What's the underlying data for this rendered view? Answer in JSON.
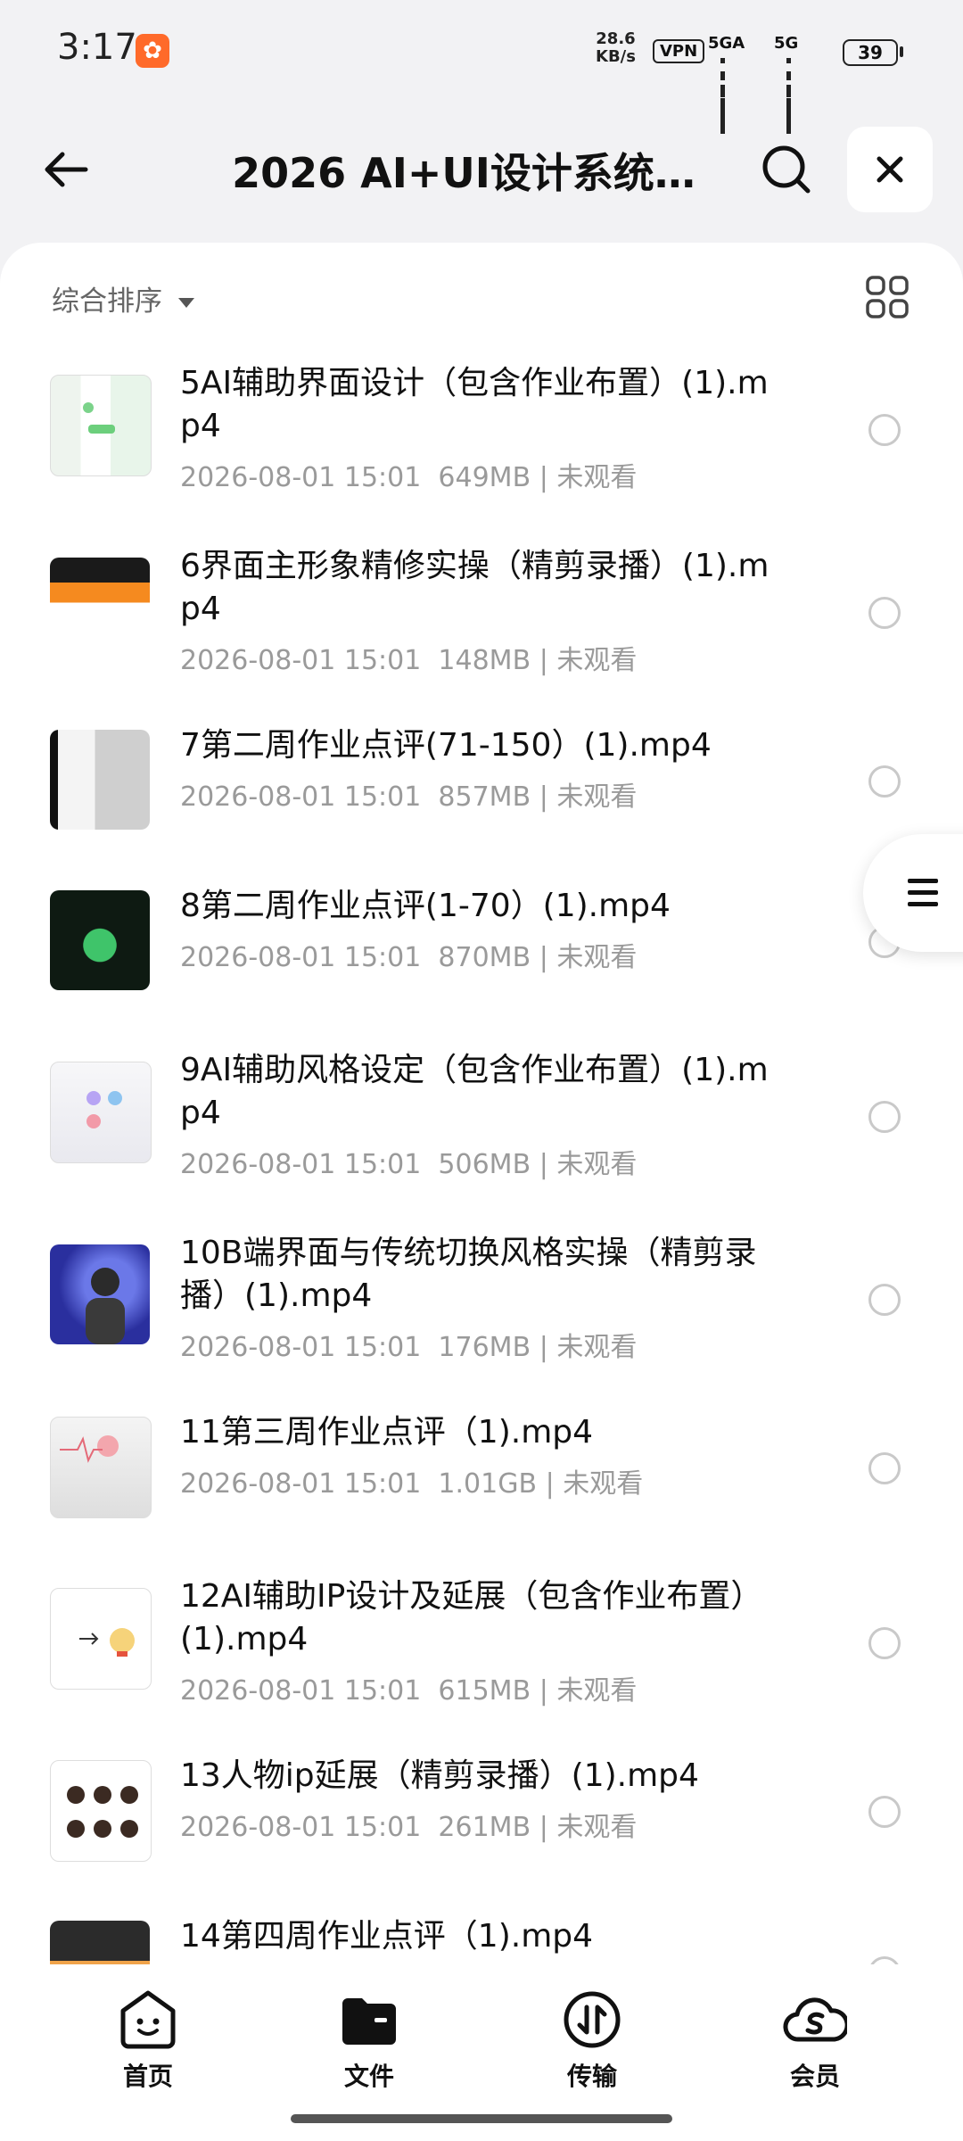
{
  "status_bar": {
    "time": "3:17",
    "app_badge_icon": "app-notification-icon",
    "net_speed_value": "28.6",
    "net_speed_unit": "KB/s",
    "vpn": "VPN",
    "sim1": "5GA",
    "sim2": "5G",
    "battery": "39"
  },
  "header": {
    "title": "2026 AI+UI设计系统…",
    "back_icon": "arrow-left-icon",
    "search_icon": "search-icon",
    "close_icon": "close-icon"
  },
  "toolbar": {
    "sort_label": "综合排序",
    "view_toggle_icon": "grid-view-icon"
  },
  "files": [
    {
      "name": "5AI辅助界面设计（包含作业布置）(1).mp4",
      "date": "2026-08-01 15:01",
      "size": "649MB",
      "status": "未观看"
    },
    {
      "name": "6界面主形象精修实操（精剪录播）(1).mp4",
      "date": "2026-08-01 15:01",
      "size": "148MB",
      "status": "未观看"
    },
    {
      "name": "7第二周作业点评(71-150）(1).mp4",
      "date": "2026-08-01 15:01",
      "size": "857MB",
      "status": "未观看"
    },
    {
      "name": "8第二周作业点评(1-70）(1).mp4",
      "date": "2026-08-01 15:01",
      "size": "870MB",
      "status": "未观看"
    },
    {
      "name": "9AI辅助风格设定（包含作业布置）(1).mp4",
      "date": "2026-08-01 15:01",
      "size": "506MB",
      "status": "未观看"
    },
    {
      "name": "10B端界面与传统切换风格实操（精剪录播）(1).mp4",
      "date": "2026-08-01 15:01",
      "size": "176MB",
      "status": "未观看"
    },
    {
      "name": "11第三周作业点评（1).mp4",
      "date": "2026-08-01 15:01",
      "size": "1.01GB",
      "status": "未观看"
    },
    {
      "name": "12AI辅助IP设计及延展（包含作业布置）(1).mp4",
      "date": "2026-08-01 15:01",
      "size": "615MB",
      "status": "未观看"
    },
    {
      "name": "13人物ip延展（精剪录播）(1).mp4",
      "date": "2026-08-01 15:01",
      "size": "261MB",
      "status": "未观看"
    },
    {
      "name": "14第四周作业点评（1).mp4",
      "date": "",
      "size": "",
      "status": ""
    }
  ],
  "floating_menu_icon": "menu-lines-icon",
  "bottom_nav": [
    {
      "label": "首页",
      "icon": "smiley-home-icon"
    },
    {
      "label": "文件",
      "icon": "folder-icon",
      "active": true
    },
    {
      "label": "传输",
      "icon": "transfer-icon"
    },
    {
      "label": "会员",
      "icon": "cloud-vip-icon"
    }
  ]
}
